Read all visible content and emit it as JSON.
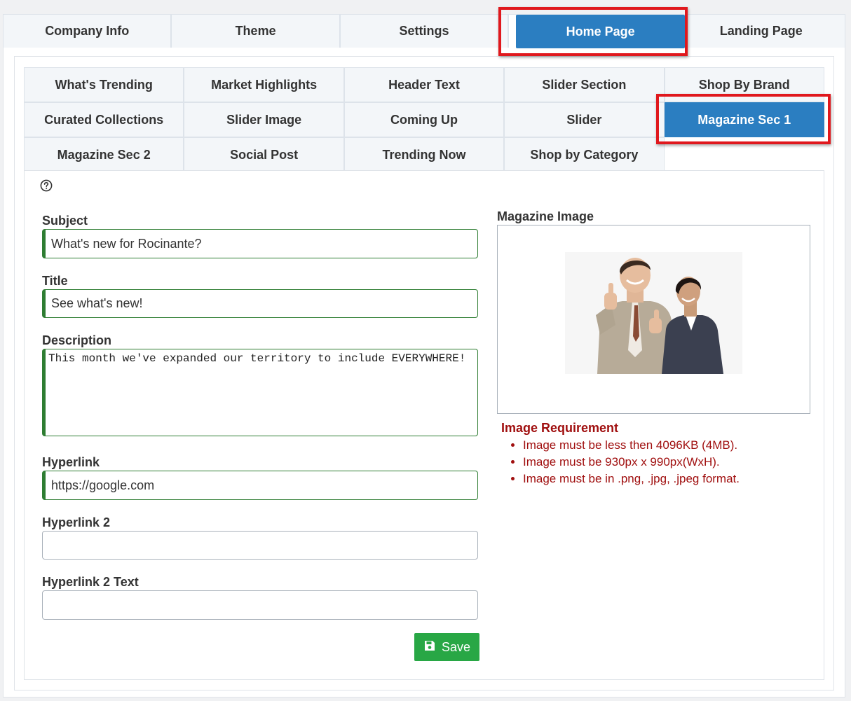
{
  "main_tabs": [
    "Company Info",
    "Theme",
    "Settings",
    "Home Page",
    "Landing Page"
  ],
  "main_active": "Home Page",
  "sub_tabs": {
    "row1": [
      "What's Trending",
      "Market Highlights",
      "Header Text",
      "Slider Section",
      "Shop By Brand"
    ],
    "row2": [
      "Curated Collections",
      "Slider Image",
      "Coming Up",
      "Slider",
      "Magazine Sec 1"
    ],
    "row3": [
      "Magazine Sec 2",
      "Social Post",
      "Trending Now",
      "Shop by Category"
    ]
  },
  "sub_active": "Magazine Sec 1",
  "help_icon": "question-circle-icon",
  "form": {
    "subject_label": "Subject",
    "subject_value": "What's new for Rocinante?",
    "title_label": "Title",
    "title_value": "See what's new!",
    "description_label": "Description",
    "description_value": "This month we've expanded our territory to include EVERYWHERE!",
    "hyperlink_label": "Hyperlink",
    "hyperlink_value": "https://google.com",
    "hyperlink2_label": "Hyperlink 2",
    "hyperlink2_value": "",
    "hyperlink2_text_label": "Hyperlink 2 Text",
    "hyperlink2_text_value": "",
    "save_label": "Save"
  },
  "image": {
    "label": "Magazine Image",
    "requirement_title": "Image Requirement",
    "requirements": [
      "Image must be less then 4096KB (4MB).",
      "Image must be 930px x 990px(WxH).",
      "Image must be in .png, .jpg, .jpeg format."
    ]
  },
  "colors": {
    "accent": "#2b7ec1",
    "highlight": "#e0181d",
    "valid_border": "#2e7d32",
    "save": "#28a745",
    "error_text": "#a00f0f"
  }
}
